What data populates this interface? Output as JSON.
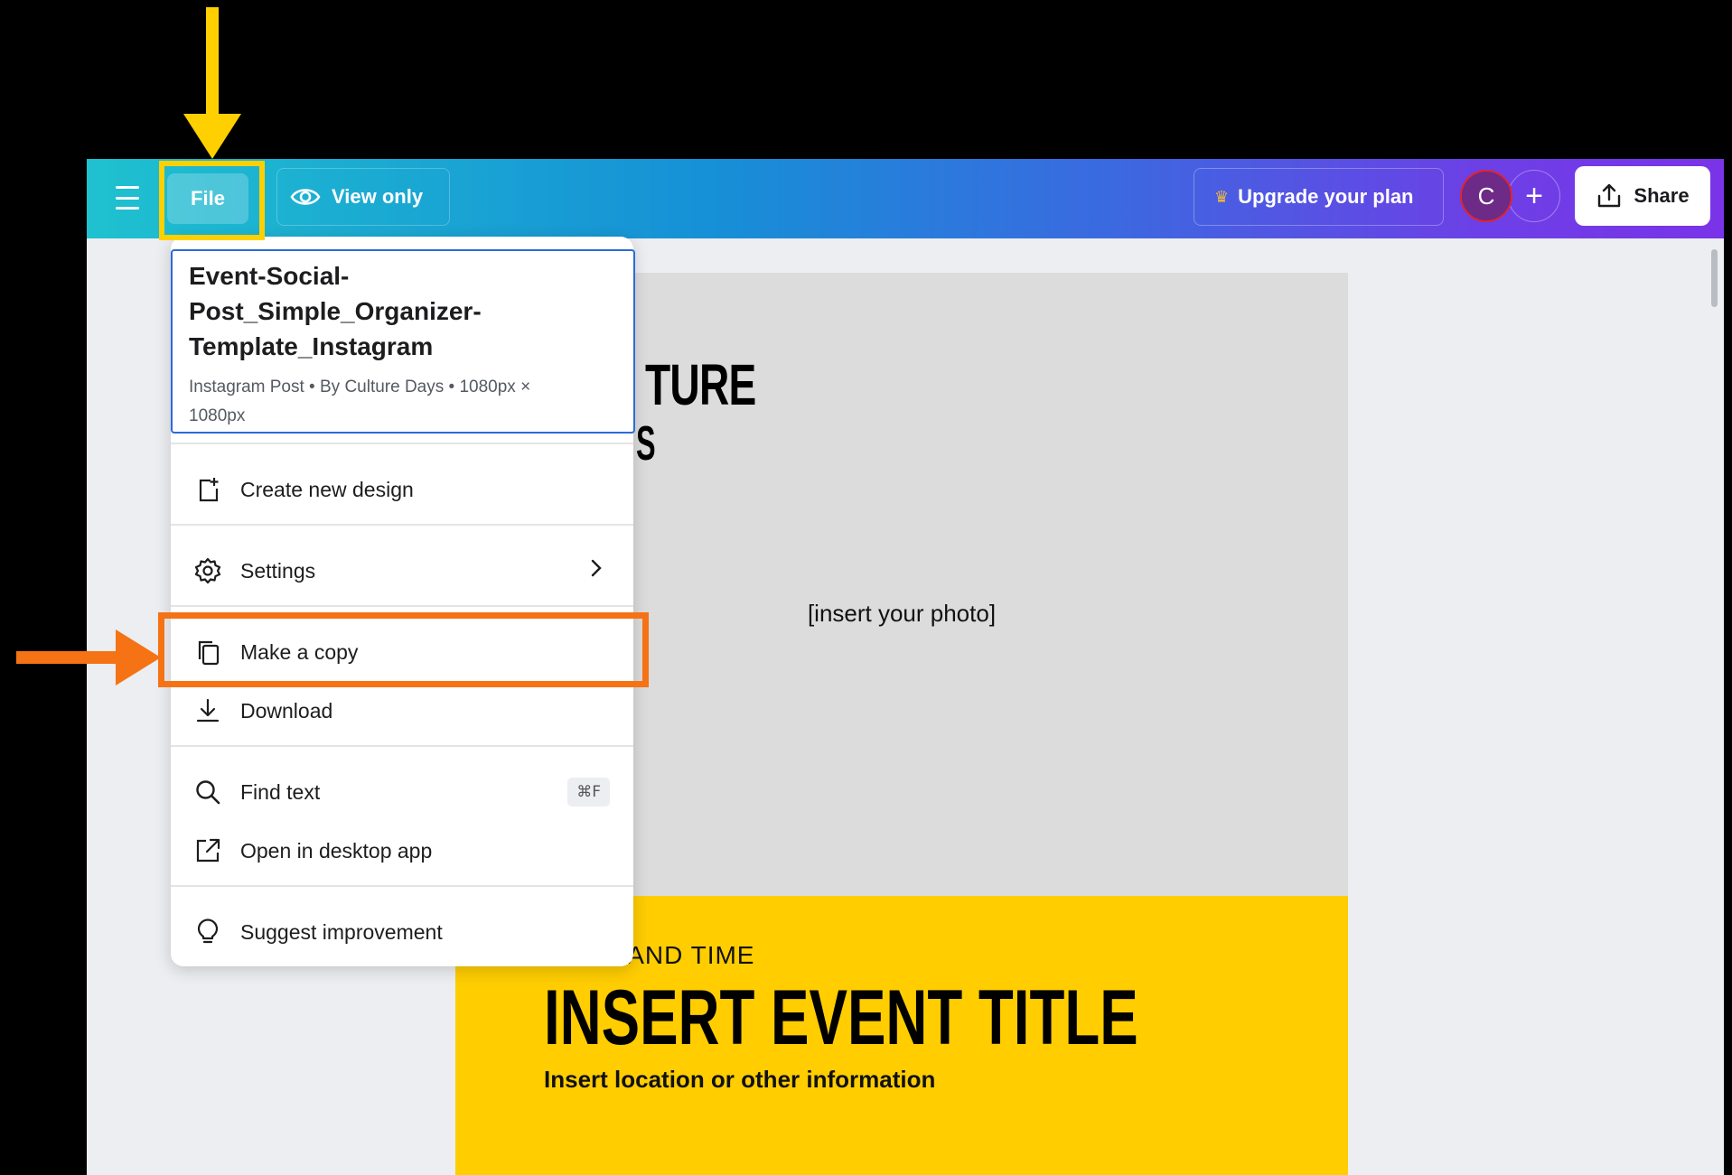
{
  "topbar": {
    "file_label": "File",
    "view_label": "View only",
    "upgrade_label": "Upgrade your plan",
    "avatar_initial": "C",
    "add_label": "+",
    "share_label": "Share"
  },
  "file_menu": {
    "doc_name": "Event-Social-Post_Simple_Organizer-Template_Instagram",
    "doc_meta": "Instagram Post • By Culture Days • 1080px × 1080px",
    "items": [
      {
        "label": "Create new design",
        "icon": "add-page-icon"
      },
      {
        "label": "Settings",
        "icon": "gear-icon"
      },
      {
        "label": "Make a copy",
        "icon": "copy-icon"
      },
      {
        "label": "Download",
        "icon": "download-icon"
      },
      {
        "label": "Find text",
        "icon": "search-icon",
        "shortcut": "⌘F"
      },
      {
        "label": "Open in desktop app",
        "icon": "external-link-icon"
      },
      {
        "label": "Suggest improvement",
        "icon": "lightbulb-icon"
      }
    ]
  },
  "canvas": {
    "title_fragment_1": "TURE",
    "title_fragment_2": "S",
    "photo_placeholder": "[insert your photo]",
    "date_fragment": "T DATE AND TIME",
    "event_title": "INSERT EVENT TITLE",
    "location": "Insert location or other information"
  },
  "annotations": {
    "highlight_file_color": "#ffd000",
    "highlight_copy_color": "#f57314"
  }
}
